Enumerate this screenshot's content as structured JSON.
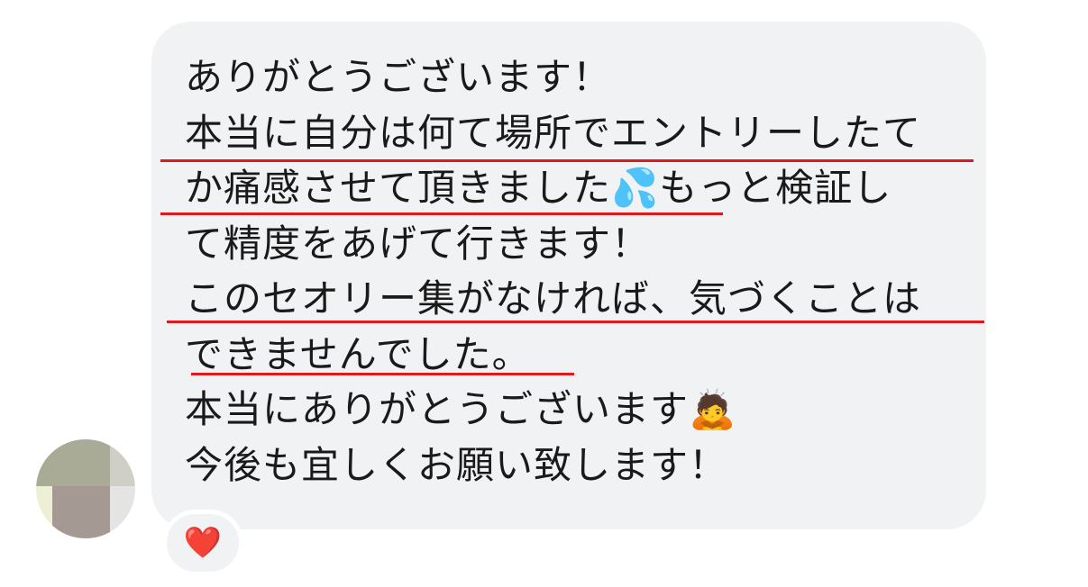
{
  "message": {
    "lines": [
      "ありがとうございます！",
      "本当に自分は何て場所でエントリーしたて",
      "か痛感させて頂きました💦もっと検証し",
      "て精度をあげて行きます！",
      "このセオリー集がなければ、気づくことは",
      "できませんでした。",
      "本当にありがとうございます🙇",
      "今後も宜しくお願い致します！"
    ]
  },
  "reaction": {
    "emoji": "❤️",
    "icon": "heart-icon"
  },
  "avatar": {
    "icon": "user-avatar"
  },
  "colors": {
    "bubble_background": "#f1f2f4",
    "underline": "#e0191c",
    "text": "#1a1a1a"
  }
}
